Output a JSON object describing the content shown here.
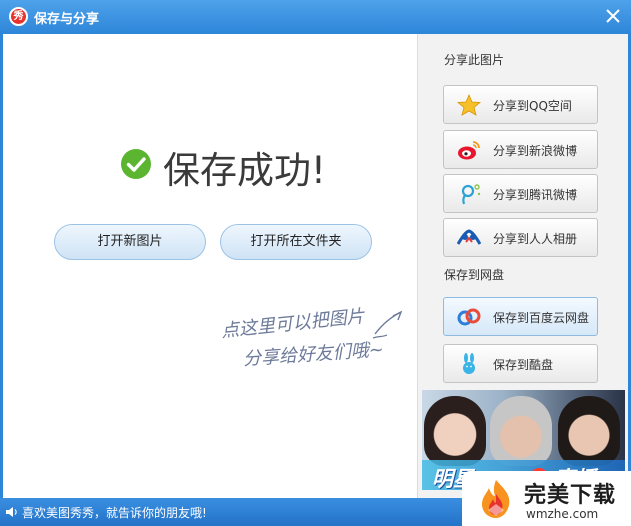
{
  "window": {
    "title": "保存与分享",
    "logo_text": "秀",
    "close_icon": "close-icon"
  },
  "main": {
    "success_text": "保存成功!",
    "buttons": {
      "open_new": "打开新图片",
      "open_folder": "打开所在文件夹"
    },
    "hint_line1": "点这里可以把图片",
    "hint_line2": "分享给好友们哦~"
  },
  "sidebar": {
    "share_section": "分享此图片",
    "share_items": [
      {
        "label": "分享到QQ空间",
        "icon": "qzone-star-icon"
      },
      {
        "label": "分享到新浪微博",
        "icon": "sina-weibo-icon"
      },
      {
        "label": "分享到腾讯微博",
        "icon": "tencent-weibo-icon"
      },
      {
        "label": "分享到人人相册",
        "icon": "renren-icon"
      }
    ],
    "save_section": "保存到网盘",
    "save_items": [
      {
        "label": "保存到百度云网盘",
        "icon": "baidu-cloud-icon"
      },
      {
        "label": "保存到酷盘",
        "icon": "kupan-rabbit-icon"
      }
    ]
  },
  "ad": {
    "title": "明星",
    "live": "直播"
  },
  "status": {
    "text": "喜欢美图秀秀，就告诉你的朋友哦!"
  },
  "watermark": {
    "brand": "完美下载",
    "url": "wmzhe.com"
  },
  "colors": {
    "title_bar": "#2e86d9",
    "success_green": "#5cb531",
    "accent_blue": "#2373c8"
  }
}
